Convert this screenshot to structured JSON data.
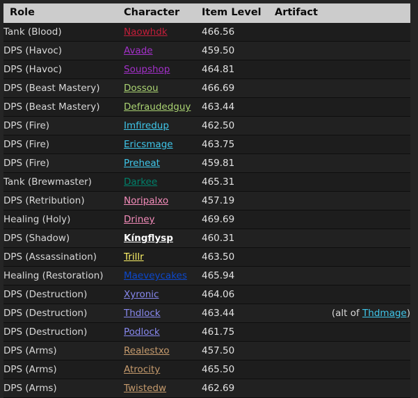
{
  "table": {
    "columns": [
      {
        "key": "role",
        "label": "Role"
      },
      {
        "key": "character",
        "label": "Character"
      },
      {
        "key": "ilvl",
        "label": "Item Level"
      },
      {
        "key": "artifact",
        "label": "Artifact"
      }
    ],
    "rows": [
      {
        "role": "Tank (Blood)",
        "character": "Naowhdk",
        "class": "deathknight",
        "ilvl": "466.56",
        "artifact": ""
      },
      {
        "role": "DPS (Havoc)",
        "character": "Avade",
        "class": "demonhunter",
        "ilvl": "459.50",
        "artifact": ""
      },
      {
        "role": "DPS (Havoc)",
        "character": "Soupshop",
        "class": "demonhunter",
        "ilvl": "464.81",
        "artifact": ""
      },
      {
        "role": "DPS (Beast Mastery)",
        "character": "Dossou",
        "class": "hunter",
        "ilvl": "466.69",
        "artifact": ""
      },
      {
        "role": "DPS (Beast Mastery)",
        "character": "Defraudedguy",
        "class": "hunter",
        "ilvl": "463.44",
        "artifact": ""
      },
      {
        "role": "DPS (Fire)",
        "character": "Imfiredup",
        "class": "mage",
        "ilvl": "462.50",
        "artifact": ""
      },
      {
        "role": "DPS (Fire)",
        "character": "Ericsmage",
        "class": "mage",
        "ilvl": "463.75",
        "artifact": ""
      },
      {
        "role": "DPS (Fire)",
        "character": "Preheat",
        "class": "mage",
        "ilvl": "459.81",
        "artifact": ""
      },
      {
        "role": "Tank (Brewmaster)",
        "character": "Darkee",
        "class": "monk",
        "ilvl": "465.31",
        "artifact": ""
      },
      {
        "role": "DPS (Retribution)",
        "character": "Noripalxo",
        "class": "paladin",
        "ilvl": "457.19",
        "artifact": ""
      },
      {
        "role": "Healing (Holy)",
        "character": "Driney",
        "class": "paladin",
        "ilvl": "469.69",
        "artifact": ""
      },
      {
        "role": "DPS (Shadow)",
        "character": "Kíngflysp",
        "class": "priest",
        "ilvl": "460.31",
        "artifact": ""
      },
      {
        "role": "DPS (Assassination)",
        "character": "Trillr",
        "class": "rogue",
        "ilvl": "463.50",
        "artifact": ""
      },
      {
        "role": "Healing (Restoration)",
        "character": "Maeveycakes",
        "class": "shaman",
        "ilvl": "465.94",
        "artifact": ""
      },
      {
        "role": "DPS (Destruction)",
        "character": "Xyronic",
        "class": "warlock",
        "ilvl": "464.06",
        "artifact": ""
      },
      {
        "role": "DPS (Destruction)",
        "character": "Thdlock",
        "class": "warlock",
        "ilvl": "463.44",
        "artifact_prefix": "(alt of ",
        "artifact_link": "Thdmage",
        "artifact_link_class": "mage",
        "artifact_suffix": ")"
      },
      {
        "role": "DPS (Destruction)",
        "character": "Podlock",
        "class": "warlock",
        "ilvl": "461.75",
        "artifact": ""
      },
      {
        "role": "DPS (Arms)",
        "character": "Realestxo",
        "class": "warrior",
        "ilvl": "457.50",
        "artifact": ""
      },
      {
        "role": "DPS (Arms)",
        "character": "Atrocity",
        "class": "warrior",
        "ilvl": "465.50",
        "artifact": ""
      },
      {
        "role": "DPS (Arms)",
        "character": "Twistedw",
        "class": "warrior",
        "ilvl": "462.69",
        "artifact": ""
      }
    ]
  },
  "colors": {
    "page_background": "#252525",
    "table_background": "#1d1d1d",
    "row_alt_background": "#212121",
    "header_background": "#cccccc",
    "header_text": "#0a0a0a",
    "body_text": "#d8d8d8",
    "row_divider": "#0e0e0e",
    "deathknight": "#C41E3A",
    "demonhunter": "#A330C9",
    "druid": "#FF7C0A",
    "hunter": "#AAD372",
    "mage": "#3FC7EB",
    "monk": "#00806A",
    "paladin": "#F48CBA",
    "priest": "#FFFFFF",
    "rogue": "#FFF468",
    "shaman": "#0C48CC",
    "warlock": "#8788EE",
    "warrior": "#C69B6D"
  }
}
